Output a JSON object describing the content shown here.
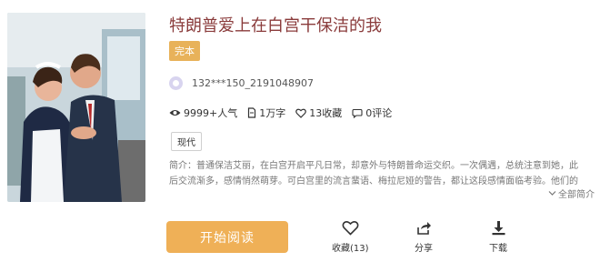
{
  "book": {
    "title": "特朗普爱上在白宫干保洁的我",
    "status": "完本",
    "author": "132***150_2191048907",
    "tag": "现代"
  },
  "stats": {
    "popularity": "9999+人气",
    "words": "1万字",
    "favorites": "13收藏",
    "comments": "0评论"
  },
  "intro": {
    "line1": "简介：普通保洁艾丽，在白宫开启平凡日常，却意外与特朗普命运交织。一次偶遇，总统注意到她，此",
    "line2": "后交流渐多，感情悄然萌芽。可白宫里的流言蜚语、梅拉尼娅的警告，都让这段感情面临考验。他们的",
    "expand_label": "全部简介"
  },
  "actions": {
    "read_label": "开始阅读",
    "favorite_label": "收藏(13)",
    "share_label": "分享",
    "download_label": "下载"
  },
  "icons": [
    "eye-icon",
    "book-icon",
    "heart-icon",
    "comment-icon",
    "chevron-down-icon",
    "share-icon",
    "download-icon"
  ],
  "colors": {
    "title": "#8a3b3b",
    "status_badge": "#e8b25a",
    "read_button": "#efb057"
  }
}
